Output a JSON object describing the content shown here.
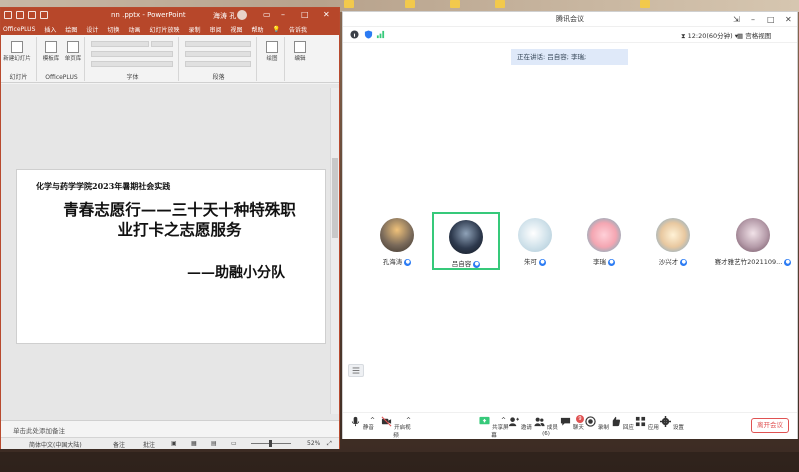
{
  "powerpoint": {
    "filename": "nn .pptx",
    "app_name": "PowerPoint",
    "user": "海涛 孔",
    "tabs": [
      "OfficePLUS",
      "插入",
      "绘图",
      "设计",
      "切换",
      "动画",
      "幻灯片放映",
      "录制",
      "审阅",
      "视图",
      "帮助"
    ],
    "tell_me": "告诉我",
    "ribbon": {
      "new_slide": "新建幻灯片",
      "template": "模板库",
      "single_page": "单页库",
      "officeplus_group": "OfficePLUS",
      "slides_group": "幻灯片",
      "font_group": "字体",
      "paragraph_group": "段落",
      "drawing": "绘图",
      "editing": "编辑"
    },
    "slide": {
      "line1": "化学与药学学院2023年暑期社会实践",
      "line2": "青春志愿行——三十天十种特殊职业打卡之志愿服务",
      "line3": "——助融小分队"
    },
    "notes_placeholder": "单击此处添加备注",
    "status": {
      "language": "简体中文(中国大陆)",
      "notes": "备注",
      "comments": "批注",
      "zoom": "52%"
    }
  },
  "meeting": {
    "title": "腾讯会议",
    "timer": "12:20(60分钟)",
    "view": "宫格视图",
    "speaking": "正在讲话: 吕自容; 李瑞;",
    "participants": [
      {
        "name": "孔海涛",
        "active": false,
        "color": "#7a6a5a"
      },
      {
        "name": "吕自容",
        "active": true,
        "color": "#2e3a4e"
      },
      {
        "name": "朱可",
        "active": false,
        "color": "#cfe1ea"
      },
      {
        "name": "李瑞",
        "active": false,
        "color": "#f4a6b2"
      },
      {
        "name": "沙兴才",
        "active": false,
        "color": "#e8c8a0"
      },
      {
        "name": "赛才雅艺竹2021109...",
        "active": false,
        "color": "#b49aa8"
      }
    ],
    "toolbar": {
      "mute": "静音",
      "video": "开启视频",
      "share": "共享屏幕",
      "invite": "邀请",
      "members": "成员(6)",
      "chat": "聊天",
      "chat_badge": "9",
      "record": "录制",
      "rooms": "回应",
      "apps": "应用",
      "settings": "设置",
      "leave": "离开会议"
    }
  }
}
